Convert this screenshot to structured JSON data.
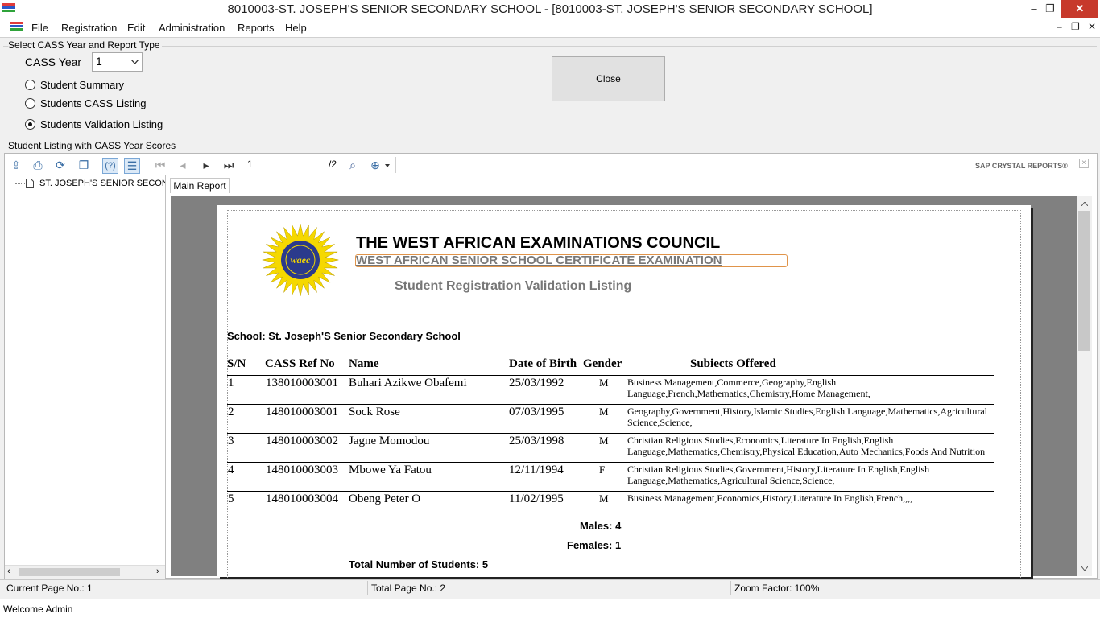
{
  "window": {
    "title": "8010003-ST. JOSEPH'S SENIOR SECONDARY SCHOOL - [8010003-ST. JOSEPH'S SENIOR SECONDARY SCHOOL]",
    "min_glyph": "‒",
    "restore_glyph": "❐",
    "close_glyph": "✕"
  },
  "menu": {
    "items": [
      "File",
      "Registration",
      "Edit",
      "Administration",
      "Reports",
      "Help"
    ],
    "mdi_min": "‒",
    "mdi_restore": "❐",
    "mdi_close": "✕"
  },
  "selection": {
    "group_label": "Select CASS Year and Report Type",
    "cass_year_label": "CASS Year",
    "cass_year_value": "1",
    "options": [
      "Student Summary",
      "Students CASS Listing",
      "Students Validation Listing"
    ],
    "selected_index": 2,
    "close_label": "Close"
  },
  "listing": {
    "group_label": "Student Listing with CASS Year Scores"
  },
  "toolbar": {
    "page_value": "1",
    "page_total": "/2",
    "brand": "SAP CRYSTAL REPORTS®"
  },
  "tree": {
    "root_label": "ST. JOSEPH'S SENIOR SECONDA"
  },
  "tabs": {
    "main": "Main Report"
  },
  "report": {
    "logo_text": "waec",
    "org": "THE WEST AFRICAN EXAMINATIONS COUNCIL",
    "exam": "WEST AFRICAN SENIOR SCHOOL CERTIFICATE EXAMINATION",
    "subtitle": "Student Registration Validation Listing",
    "school": "School: St. Joseph'S Senior Secondary School",
    "headers": {
      "sn": "S/N",
      "ref": "CASS Ref No",
      "name": "Name",
      "dob": "Date of Birth",
      "gender": "Gender",
      "subjects": "Subiects Offered"
    },
    "rows": [
      {
        "sn": "1",
        "ref": "138010003001",
        "name": "Buhari Azikwe Obafemi",
        "dob": "25/03/1992",
        "gender": "M",
        "subjects": "Business Management,Commerce,Geography,English Language,French,Mathematics,Chemistry,Home Management,"
      },
      {
        "sn": "2",
        "ref": "148010003001",
        "name": "Sock Rose",
        "dob": "07/03/1995",
        "gender": "M",
        "subjects": "Geography,Government,History,Islamic Studies,English Language,Mathematics,Agricultural Science,Science,"
      },
      {
        "sn": "3",
        "ref": "148010003002",
        "name": "Jagne Momodou",
        "dob": "25/03/1998",
        "gender": "M",
        "subjects": "Christian Religious Studies,Economics,Literature In English,English Language,Mathematics,Chemistry,Physical Education,Auto Mechanics,Foods And Nutrition"
      },
      {
        "sn": "4",
        "ref": "148010003003",
        "name": "Mbowe Ya Fatou",
        "dob": "12/11/1994",
        "gender": "F",
        "subjects": "Christian Religious Studies,Government,History,Literature In English,English Language,Mathematics,Agricultural Science,Science,"
      },
      {
        "sn": "5",
        "ref": "148010003004",
        "name": "Obeng Peter O",
        "dob": "11/02/1995",
        "gender": "M",
        "subjects": "Business Management,Economics,History,Literature In English,French,,,,"
      }
    ],
    "males": "Males: 4",
    "females": "Females: 1",
    "total": "Total Number of Students: 5"
  },
  "status": {
    "current_page": "Current Page No.: 1",
    "total_page": "Total Page No.: 2",
    "zoom": "Zoom Factor: 100%"
  },
  "footer": {
    "welcome": "Welcome Admin"
  },
  "colors": {
    "title_close": "#c7392b",
    "accent_blue": "#3a6ea5",
    "canvas_gray": "#808080",
    "logo_blue": "#2b3a8c",
    "logo_yellow": "#f5d800"
  }
}
